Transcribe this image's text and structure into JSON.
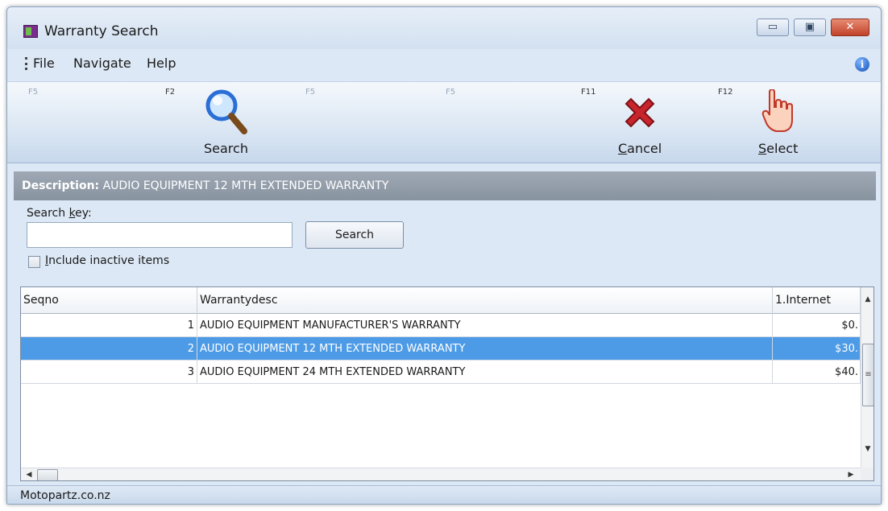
{
  "window": {
    "title": "Warranty Search",
    "min_glyph": "▭",
    "max_glyph": "▣",
    "close_glyph": "✕"
  },
  "menu": {
    "file": "File",
    "navigate": "Navigate",
    "help": "Help",
    "info_glyph": "i"
  },
  "toolbar": {
    "fkeys": [
      "F5",
      "F2",
      "F5",
      "F5",
      "F11",
      "F12"
    ],
    "search_label": "Search",
    "cancel_first": "C",
    "cancel_rest": "ancel",
    "select_first": "S",
    "select_rest": "elect"
  },
  "description": {
    "label": "Description:",
    "value": "AUDIO EQUIPMENT 12 MTH EXTENDED WARRANTY"
  },
  "search": {
    "key_label_a": "Search ",
    "key_label_u": "k",
    "key_label_b": "ey:",
    "input_value": "",
    "button_label": "Search",
    "inactive_u": "I",
    "inactive_rest": "nclude inactive items"
  },
  "grid": {
    "columns": [
      "Seqno",
      "Warrantydesc",
      "1.Internet"
    ],
    "rows": [
      {
        "seqno": "1",
        "desc": "AUDIO EQUIPMENT MANUFACTURER'S WARRANTY",
        "price": "$0.",
        "selected": false
      },
      {
        "seqno": "2",
        "desc": "AUDIO EQUIPMENT 12 MTH EXTENDED WARRANTY",
        "price": "$30.",
        "selected": true
      },
      {
        "seqno": "3",
        "desc": "AUDIO EQUIPMENT 24 MTH EXTENDED WARRANTY",
        "price": "$40.",
        "selected": false
      }
    ]
  },
  "status": {
    "text": "Motopartz.co.nz"
  },
  "colors": {
    "selection": "#4d9be6",
    "description_bar": "#8f99a6",
    "cancel_icon": "#c8242c",
    "search_icon": "#2b6fd6"
  }
}
